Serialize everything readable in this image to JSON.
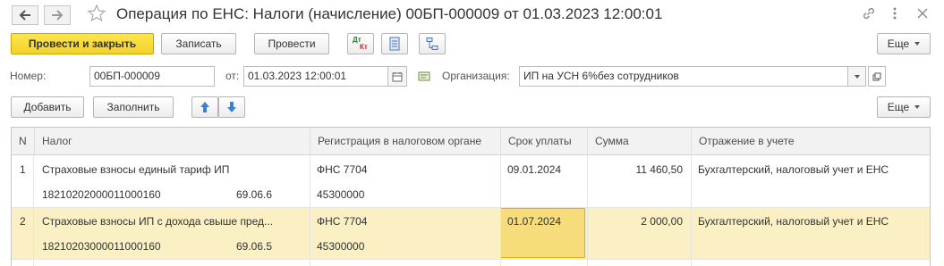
{
  "window": {
    "title": "Операция по ЕНС: Налоги (начисление) 00БП-000009 от 01.03.2023 12:00:01"
  },
  "toolbar": {
    "post_close_label": "Провести и закрыть",
    "save_label": "Записать",
    "post_label": "Провести",
    "dtkt_dt": "Дт",
    "dtkt_kt": "Кт",
    "more_label": "Еще"
  },
  "header": {
    "number_label": "Номер:",
    "number_value": "00БП-000009",
    "date_label": "от:",
    "date_value": "01.03.2023 12:00:01",
    "org_label": "Организация:",
    "org_value": "ИП на УСН 6%без сотрудников"
  },
  "table_toolbar": {
    "add_label": "Добавить",
    "fill_label": "Заполнить",
    "more_label": "Еще"
  },
  "table": {
    "columns": [
      "N",
      "Налог",
      "Регистрация в налоговом органе",
      "Срок уплаты",
      "Сумма",
      "Отражение в учете"
    ],
    "rows": [
      {
        "n": "1",
        "tax": "Страховые взносы единый тариф ИП",
        "kbk": "18210202000011000160",
        "account": "69.06.6",
        "registration": "ФНС 7704",
        "oktmo": "45300000",
        "due_date": "09.01.2024",
        "amount": "11 460,50",
        "reflection": "Бухгалтерский, налоговый учет и ЕНС"
      },
      {
        "n": "2",
        "tax": "Страховые взносы ИП с дохода свыше пред...",
        "kbk": "18210203000011000160",
        "account": "69.06.5",
        "registration": "ФНС 7704",
        "oktmo": "45300000",
        "due_date": "01.07.2024",
        "amount": "2 000,00",
        "reflection": "Бухгалтерский, налоговый учет и ЕНС"
      }
    ]
  }
}
